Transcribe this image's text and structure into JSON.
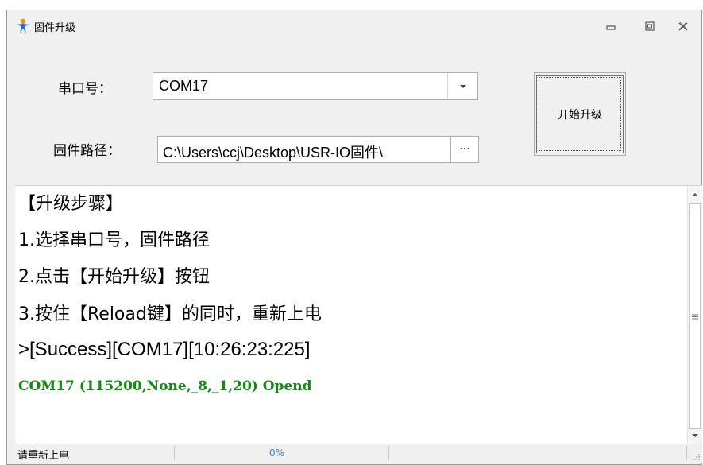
{
  "window": {
    "title": "固件升级",
    "minimize_label": "▭",
    "maximize_label": "▣",
    "close_label": "✕"
  },
  "form": {
    "port_label": "串口号：",
    "port_value": "COM17",
    "path_label": "固件路径：",
    "path_value": "C:\\Users\\ccj\\Desktop\\USR-IO固件\\",
    "browse_label": "···",
    "start_button_label": "开始升级"
  },
  "log": {
    "lines": [
      "【升级步骤】",
      "1.选择串口号，固件路径",
      "2.点击【开始升级】按钮",
      "3.按住【Reload键】的同时，重新上电",
      ">[Success][COM17][10:26:23:225]",
      "COM17 (115200,None,_8,_1,20) Opend"
    ]
  },
  "status": {
    "text": "请重新上电",
    "progress_percent": 0,
    "progress_label": "0%"
  },
  "colors": {
    "success_green": "#128a12",
    "progress_blue": "#3c7fd1",
    "icon_blue": "#1e6fd6",
    "icon_orange": "#f08a1c"
  },
  "icons": {
    "app": "person-star-icon",
    "combo": "dropdown-arrow-icon",
    "scroll_up": "scroll-up-arrow-icon",
    "scroll_down": "scroll-down-arrow-icon",
    "grip": "size-grip-icon"
  }
}
